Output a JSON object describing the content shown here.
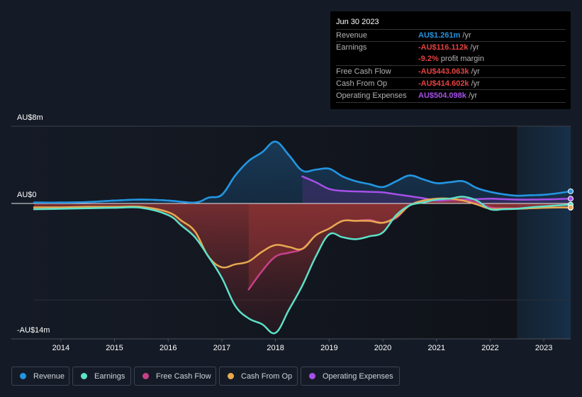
{
  "tooltip": {
    "date": "Jun 30 2023",
    "rows": [
      {
        "label": "Revenue",
        "value": "AU$1.261m",
        "unit": " /yr",
        "color": "#2394df"
      },
      {
        "label": "Earnings",
        "value": "-AU$116.112k",
        "unit": " /yr",
        "color": "#e64141"
      },
      {
        "label": "",
        "value": "-9.2%",
        "unit": " profit margin",
        "color": "#e64141"
      },
      {
        "label": "Free Cash Flow",
        "value": "-AU$443.063k",
        "unit": " /yr",
        "color": "#e64141"
      },
      {
        "label": "Cash From Op",
        "value": "-AU$414.602k",
        "unit": " /yr",
        "color": "#e64141"
      },
      {
        "label": "Operating Expenses",
        "value": "AU$504.098k",
        "unit": " /yr",
        "color": "#a650e8"
      }
    ]
  },
  "legend": [
    {
      "label": "Revenue",
      "color": "#2394df"
    },
    {
      "label": "Earnings",
      "color": "#5de0c8"
    },
    {
      "label": "Free Cash Flow",
      "color": "#c6418a"
    },
    {
      "label": "Cash From Op",
      "color": "#e8a94f"
    },
    {
      "label": "Operating Expenses",
      "color": "#a650e8"
    }
  ],
  "chart_data": {
    "type": "area",
    "title": "",
    "xlabel": "",
    "ylabel": "",
    "unit": "AU$m",
    "ylim": [
      -14,
      8
    ],
    "xlim": [
      2013.5,
      2023.5
    ],
    "y_tick_labels": [
      {
        "value": 8,
        "label": "AU$8m"
      },
      {
        "value": 0,
        "label": "AU$0"
      },
      {
        "value": -14,
        "label": "-AU$14m"
      }
    ],
    "x_tick_labels": [
      "2014",
      "2015",
      "2016",
      "2017",
      "2018",
      "2019",
      "2020",
      "2021",
      "2022",
      "2023"
    ],
    "x_ticks": [
      2014,
      2015,
      2016,
      2017,
      2018,
      2019,
      2020,
      2021,
      2022,
      2023
    ],
    "forecast_region_start": 2022.5,
    "grid": true,
    "legend_position": "bottom",
    "series": [
      {
        "name": "Revenue",
        "color": "#2394df",
        "x": [
          2013.5,
          2014.0,
          2014.5,
          2015.0,
          2015.5,
          2016.0,
          2016.5,
          2016.75,
          2017.0,
          2017.25,
          2017.5,
          2017.75,
          2018.0,
          2018.25,
          2018.5,
          2018.75,
          2019.0,
          2019.25,
          2019.5,
          2019.75,
          2020.0,
          2020.25,
          2020.5,
          2020.75,
          2021.0,
          2021.25,
          2021.5,
          2021.75,
          2022.0,
          2022.25,
          2022.5,
          2022.75,
          2023.0,
          2023.25,
          2023.5
        ],
        "values": [
          0.1,
          0.1,
          0.15,
          0.3,
          0.4,
          0.3,
          0.1,
          0.6,
          0.9,
          2.9,
          4.4,
          5.3,
          6.4,
          5.0,
          3.4,
          3.5,
          3.6,
          2.8,
          2.3,
          2.0,
          1.7,
          2.3,
          2.9,
          2.5,
          2.1,
          2.2,
          2.3,
          1.6,
          1.2,
          0.95,
          0.8,
          0.85,
          0.9,
          1.05,
          1.26
        ]
      },
      {
        "name": "Earnings",
        "color": "#5de0c8",
        "x": [
          2013.5,
          2014.0,
          2014.5,
          2015.0,
          2015.5,
          2016.0,
          2016.25,
          2016.5,
          2016.75,
          2017.0,
          2017.25,
          2017.5,
          2017.75,
          2018.0,
          2018.25,
          2018.5,
          2018.75,
          2019.0,
          2019.25,
          2019.5,
          2019.75,
          2020.0,
          2020.25,
          2020.5,
          2020.75,
          2021.0,
          2021.25,
          2021.5,
          2021.75,
          2022.0,
          2022.25,
          2022.5,
          2022.75,
          2023.0,
          2023.25,
          2023.5
        ],
        "values": [
          -0.6,
          -0.55,
          -0.5,
          -0.45,
          -0.45,
          -1.2,
          -2.3,
          -3.5,
          -5.5,
          -7.7,
          -10.6,
          -11.9,
          -12.5,
          -13.4,
          -11.0,
          -8.5,
          -5.5,
          -3.2,
          -3.5,
          -3.7,
          -3.4,
          -3.0,
          -1.2,
          -0.2,
          0.1,
          0.4,
          0.5,
          0.7,
          0.3,
          -0.6,
          -0.6,
          -0.55,
          -0.4,
          -0.3,
          -0.2,
          -0.12
        ]
      },
      {
        "name": "Free Cash Flow",
        "color": "#c6418a",
        "x": [
          2017.5,
          2017.75,
          2018.0,
          2018.25,
          2018.5,
          2018.75,
          2019.0,
          2019.25,
          2019.5,
          2019.75,
          2020.0,
          2020.25,
          2020.5,
          2020.75,
          2021.0,
          2021.25,
          2021.5,
          2021.75,
          2022.0,
          2022.25,
          2022.5,
          2022.75,
          2023.0,
          2023.25,
          2023.5
        ],
        "values": [
          -8.9,
          -7.0,
          -5.5,
          -5.1,
          -4.7,
          -3.3,
          -2.6,
          -1.8,
          -1.8,
          -1.7,
          -2.0,
          -1.5,
          -0.2,
          0.2,
          0.4,
          0.4,
          0.3,
          0.1,
          -0.4,
          -0.5,
          -0.5,
          -0.45,
          -0.4,
          -0.42,
          -0.44
        ]
      },
      {
        "name": "Cash From Op",
        "color": "#e8a94f",
        "x": [
          2013.5,
          2014.0,
          2014.5,
          2015.0,
          2015.5,
          2016.0,
          2016.25,
          2016.5,
          2016.75,
          2017.0,
          2017.25,
          2017.5,
          2017.75,
          2018.0,
          2018.25,
          2018.5,
          2018.75,
          2019.0,
          2019.25,
          2019.5,
          2019.75,
          2020.0,
          2020.25,
          2020.5,
          2020.75,
          2021.0,
          2021.25,
          2021.5,
          2021.75,
          2022.0,
          2022.25,
          2022.5,
          2022.75,
          2023.0,
          2023.25,
          2023.5
        ],
        "values": [
          -0.4,
          -0.4,
          -0.35,
          -0.35,
          -0.35,
          -0.9,
          -1.8,
          -2.9,
          -5.5,
          -6.6,
          -6.3,
          -6.0,
          -5.0,
          -4.3,
          -4.5,
          -4.7,
          -3.3,
          -2.6,
          -1.8,
          -1.8,
          -1.8,
          -2.0,
          -1.4,
          -0.2,
          0.3,
          0.5,
          0.5,
          0.3,
          -0.1,
          -0.55,
          -0.55,
          -0.55,
          -0.5,
          -0.45,
          -0.42,
          -0.41
        ]
      },
      {
        "name": "Operating Expenses",
        "color": "#a650e8",
        "x": [
          2018.5,
          2018.75,
          2019.0,
          2019.25,
          2019.5,
          2019.75,
          2020.0,
          2020.25,
          2020.5,
          2020.75,
          2021.0,
          2021.25,
          2021.5,
          2021.75,
          2022.0,
          2022.25,
          2022.5,
          2022.75,
          2023.0,
          2023.25,
          2023.5
        ],
        "values": [
          2.8,
          2.2,
          1.5,
          1.3,
          1.25,
          1.2,
          1.15,
          0.95,
          0.75,
          0.55,
          0.3,
          0.35,
          0.4,
          0.45,
          0.5,
          0.45,
          0.4,
          0.4,
          0.42,
          0.45,
          0.5
        ]
      }
    ]
  }
}
